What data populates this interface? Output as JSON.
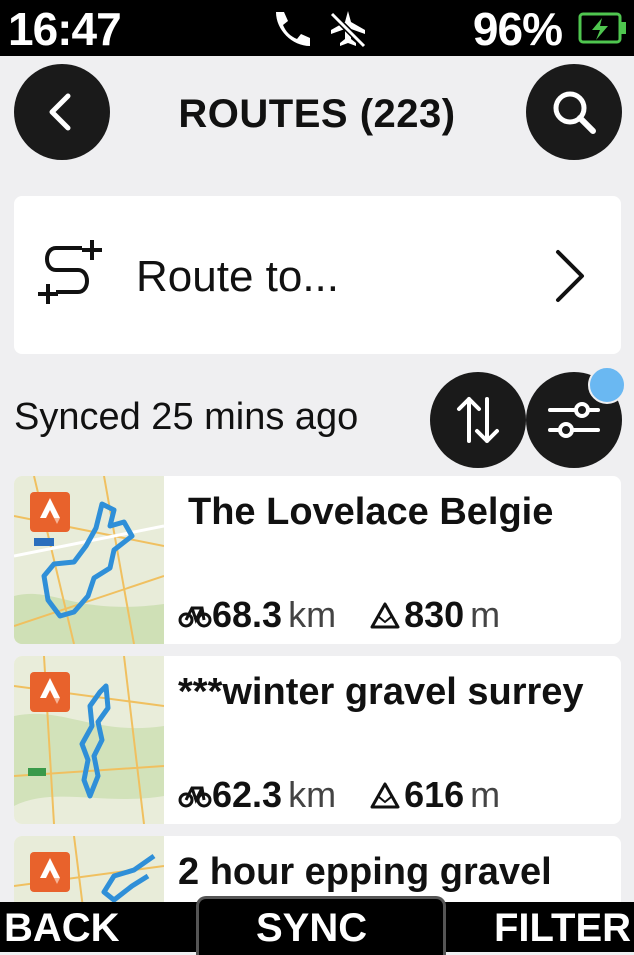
{
  "status": {
    "time": "16:47",
    "battery": "96%"
  },
  "header": {
    "title": "ROUTES (223)"
  },
  "route_to": {
    "label": "Route to..."
  },
  "sync": {
    "status": "Synced 25 mins ago"
  },
  "routes": [
    {
      "name": "The Lovelace Belgie",
      "distance": "68.3",
      "distance_unit": "km",
      "elevation": "830",
      "elevation_unit": "m"
    },
    {
      "name": "***winter gravel surrey",
      "distance": "62.3",
      "distance_unit": "km",
      "elevation": "616",
      "elevation_unit": "m"
    },
    {
      "name": "2 hour epping gravel",
      "distance": "",
      "distance_unit": "",
      "elevation": "",
      "elevation_unit": ""
    }
  ],
  "bottom": {
    "back": "BACK",
    "sync": "SYNC",
    "filter": "FILTER"
  },
  "colors": {
    "accent": "#e8622c",
    "route_line": "#2f8fd8",
    "badge": "#6ab8f2"
  },
  "icons": [
    "phone-icon",
    "airplane-off-icon",
    "battery-charging-icon",
    "back-arrow-icon",
    "search-icon",
    "route-plus-icon",
    "chevron-right-icon",
    "sort-icon",
    "filter-sliders-icon",
    "strava-icon",
    "bike-icon",
    "elevation-icon"
  ]
}
